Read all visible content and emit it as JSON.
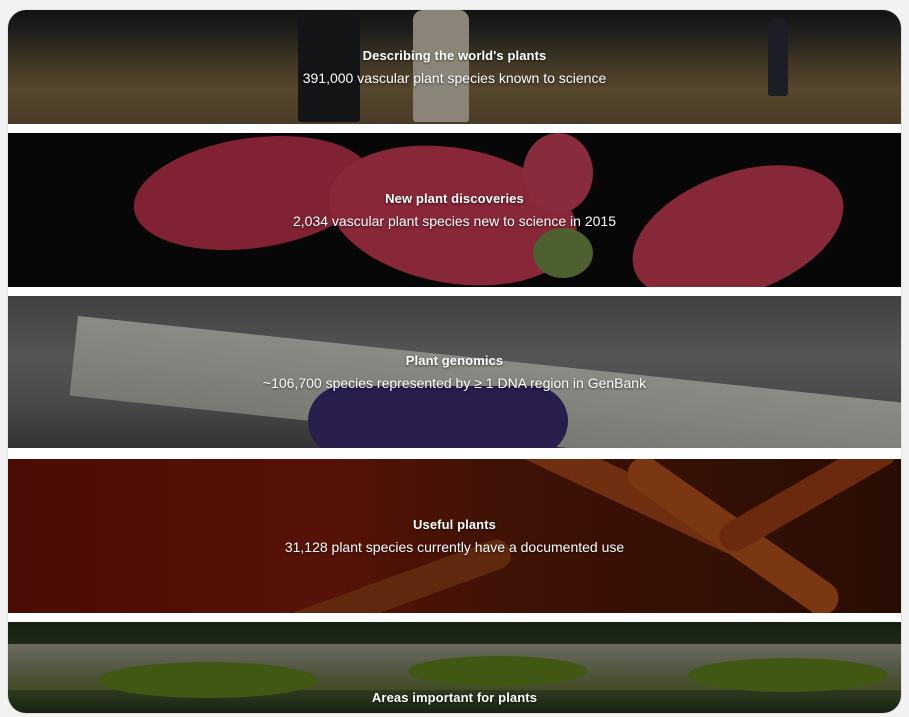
{
  "panels": [
    {
      "title": "Describing the world's plants",
      "stat": "391,000 vascular plant species known to science"
    },
    {
      "title": "New plant discoveries",
      "stat": "2,034 vascular plant species new to science in 2015"
    },
    {
      "title": "Plant genomics",
      "stat": "~106,700 species represented by ≥ 1 DNA region in GenBank"
    },
    {
      "title": "Useful plants",
      "stat": "31,128 plant species currently have a documented use"
    },
    {
      "title": "Areas important for plants"
    }
  ]
}
